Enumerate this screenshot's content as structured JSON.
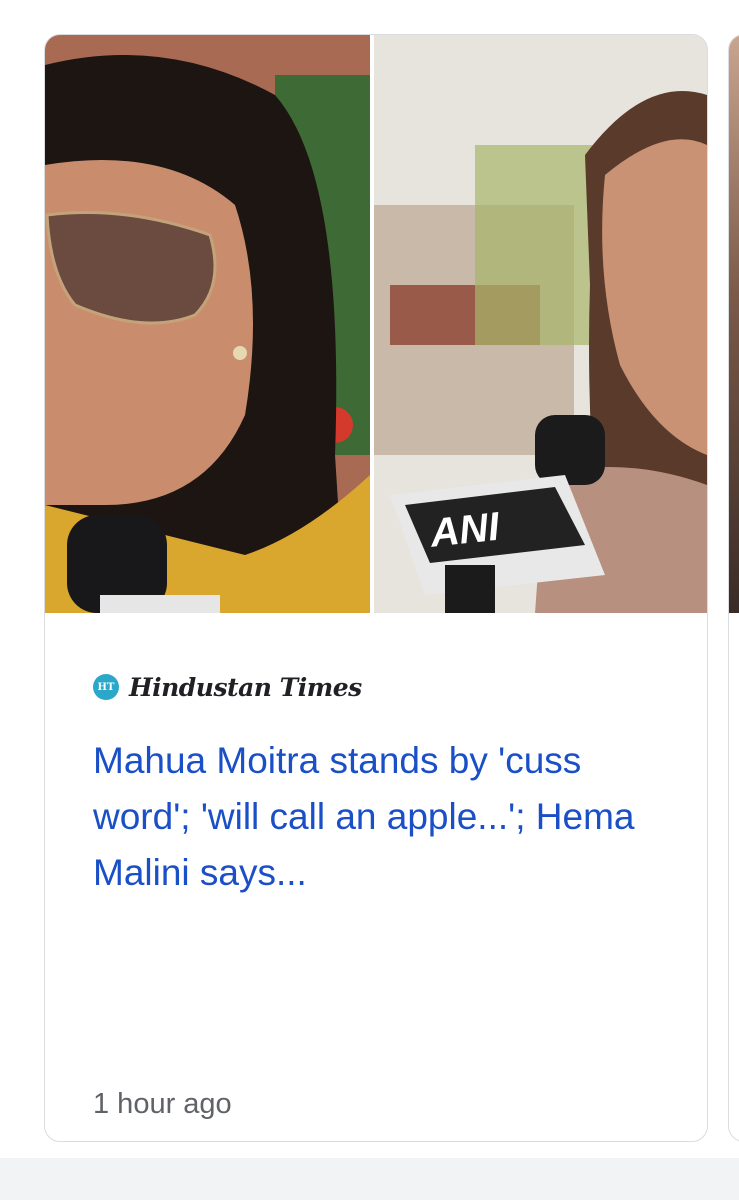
{
  "news_card": {
    "source": {
      "logo_text": "HT",
      "name": "Hindustan Times"
    },
    "headline": "Mahua Moitra stands by 'cuss word'; 'will call an apple...'; Hema Malini says...",
    "timestamp": "1 hour ago",
    "thumbnail": {
      "mic_label": "ANI"
    },
    "colors": {
      "headline": "#1a4fc7",
      "timestamp": "#5f6368",
      "logo": "#2aa7c9",
      "border": "#dadce0"
    }
  }
}
